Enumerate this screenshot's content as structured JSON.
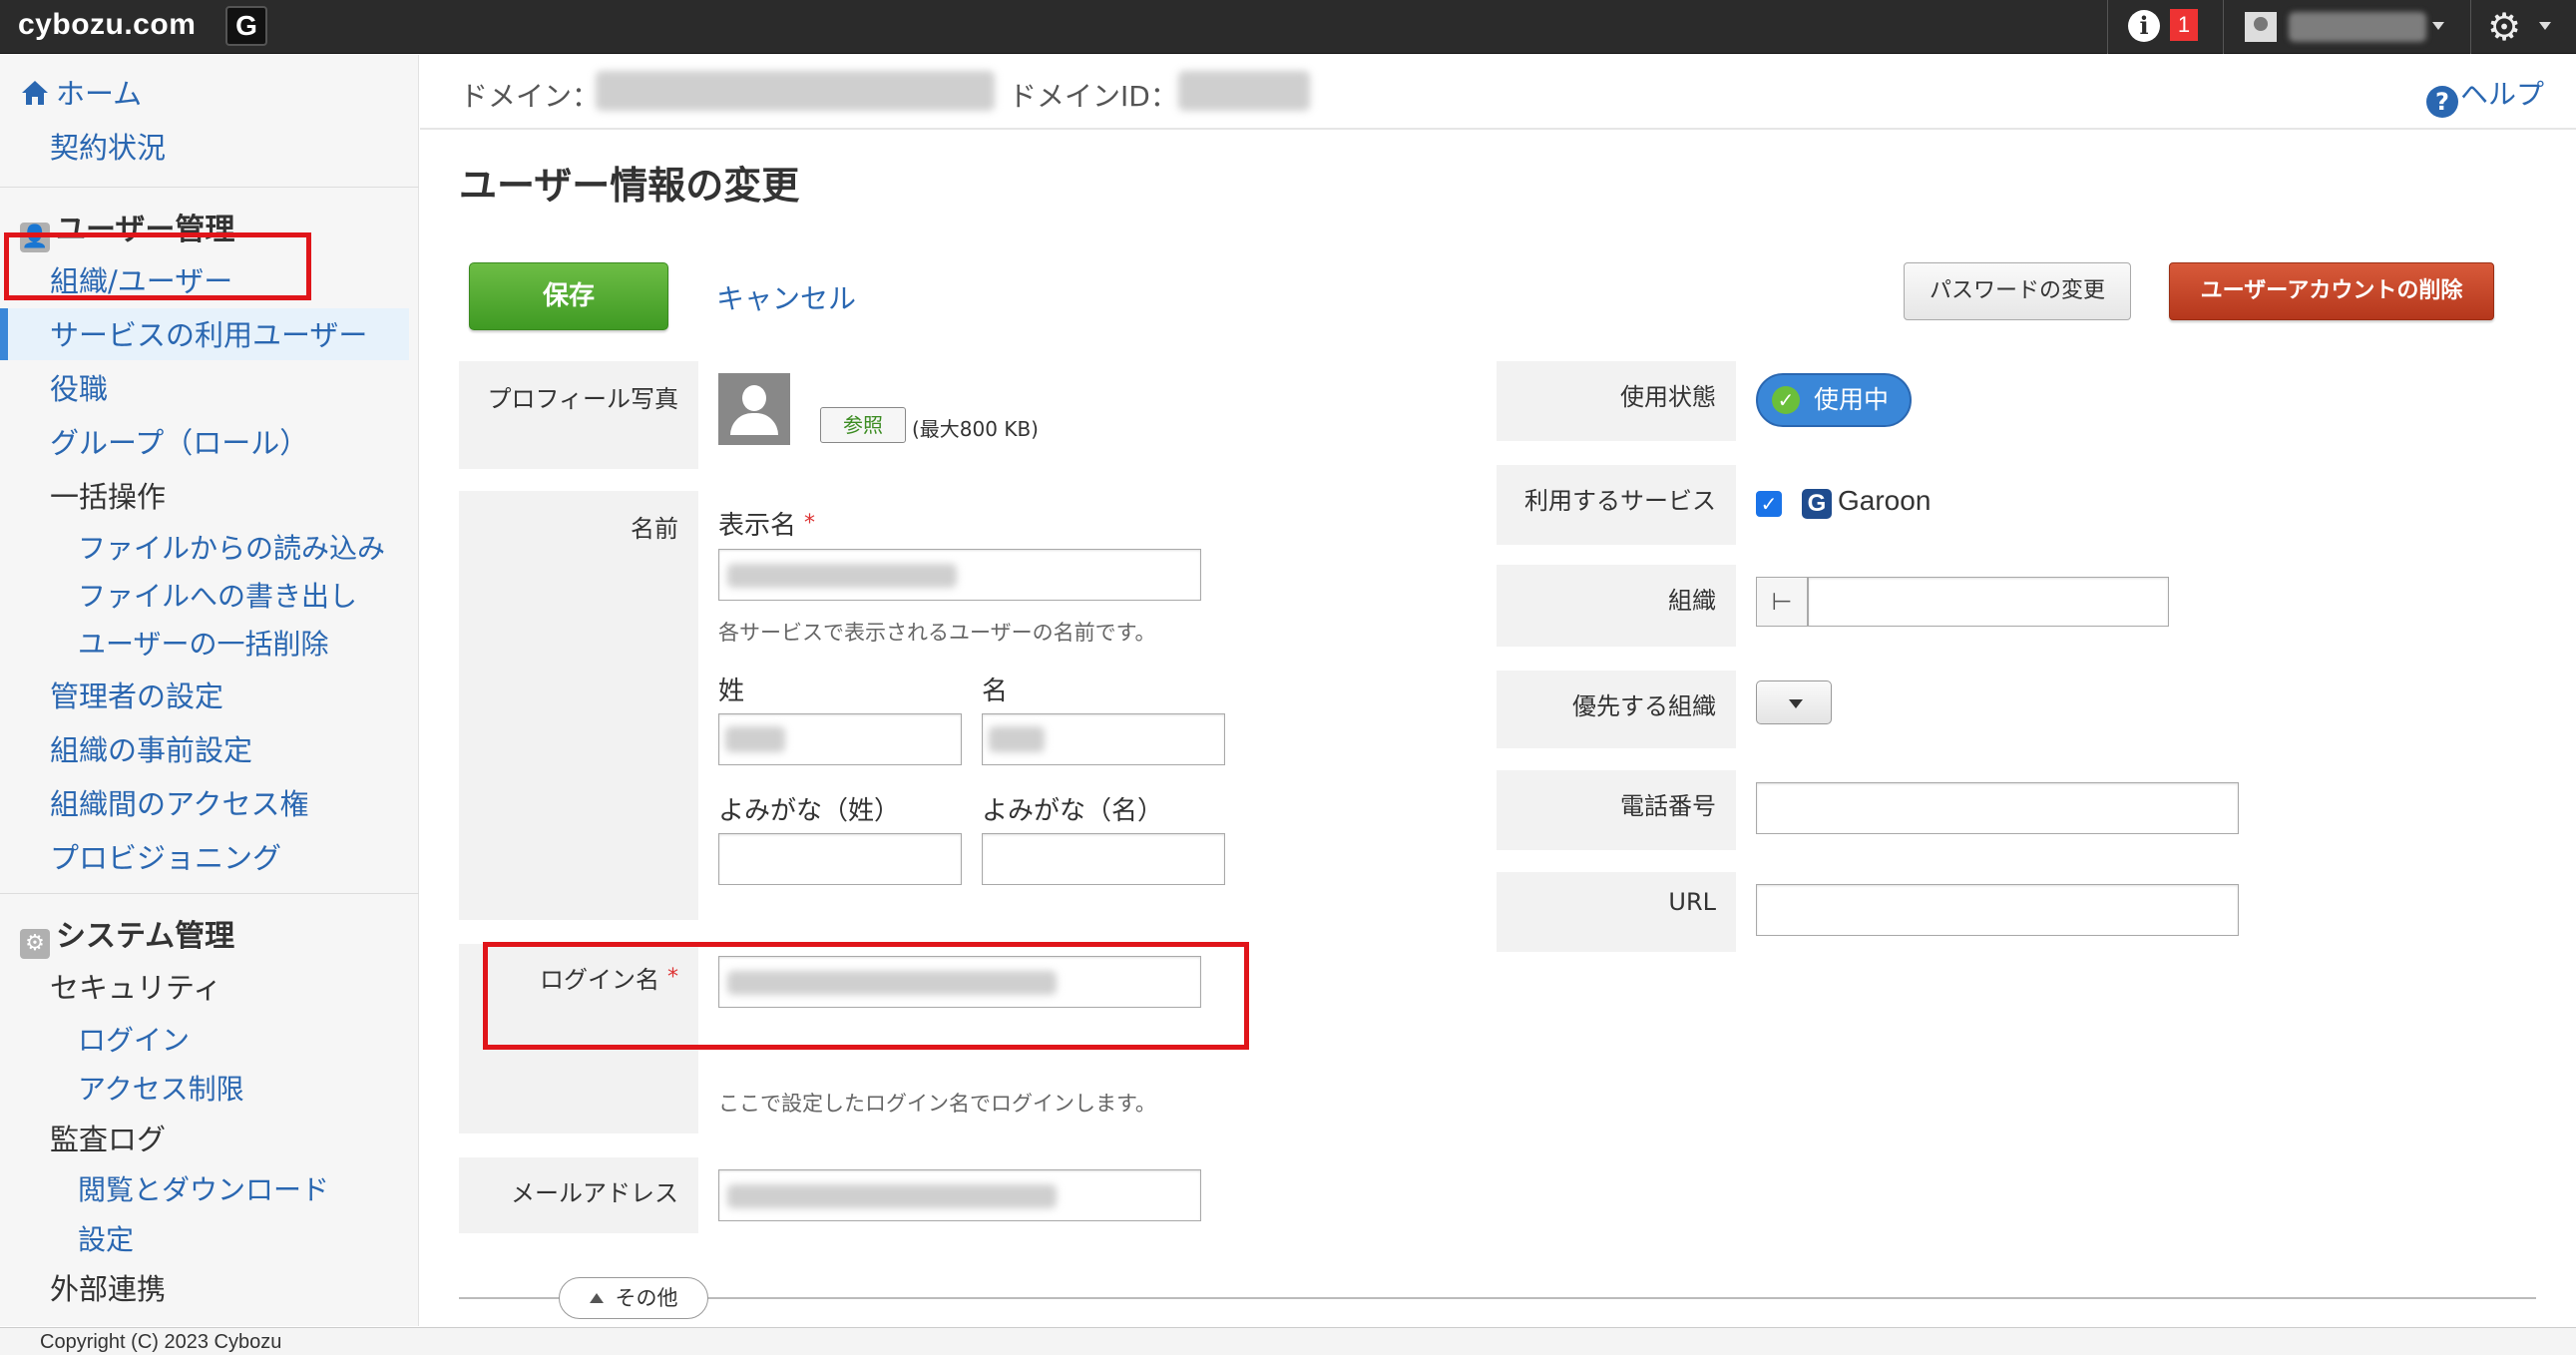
{
  "topbar": {
    "logo": "cybozu.com",
    "app_button": "G",
    "info_icon": "i",
    "notification_count": "1",
    "user_name": "",
    "icons": [
      "info-icon",
      "avatar-icon",
      "gear-icon"
    ]
  },
  "sidebar": {
    "home": "ホーム",
    "contract": "契約状況",
    "user_mgmt_header": "ユーザー管理",
    "org_users": "組織/ユーザー",
    "service_users": "サービスの利用ユーザー",
    "roles": "役職",
    "groups": "グループ（ロール）",
    "bulk_ops": "一括操作",
    "import_file": "ファイルからの読み込み",
    "export_file": "ファイルへの書き出し",
    "bulk_delete": "ユーザーの一括削除",
    "admin_settings": "管理者の設定",
    "org_preset": "組織の事前設定",
    "inter_org_access": "組織間のアクセス権",
    "provisioning": "プロビジョニング",
    "system_header": "システム管理",
    "security": "セキュリティ",
    "login": "ログイン",
    "access_restriction": "アクセス制限",
    "audit_log": "監査ログ",
    "view_download": "閲覧とダウンロード",
    "settings": "設定",
    "external_integration": "外部連携"
  },
  "domain_bar": {
    "domain_label": "ドメイン：",
    "domain_value": "",
    "domain_id_label": "ドメインID：",
    "domain_id_value": "",
    "help": "ヘルプ"
  },
  "page": {
    "title": "ユーザー情報の変更",
    "save": "保存",
    "cancel": "キャンセル",
    "change_password": "パスワードの変更",
    "delete_account": "ユーザーアカウントの削除"
  },
  "form": {
    "profile_photo_label": "プロフィール写真",
    "browse": "参照",
    "max_size": "(最大800 KB)",
    "name_label": "名前",
    "display_name_label": "表示名",
    "required_mark": "*",
    "display_name_hint": "各サービスで表示されるユーザーの名前です。",
    "last_name_label": "姓",
    "first_name_label": "名",
    "last_kana_label": "よみがな（姓）",
    "first_kana_label": "よみがな（名）",
    "login_name_label": "ログイン名",
    "login_hint": "ここで設定したログイン名でログインします。",
    "email_label": "メールアドレス",
    "status_label": "使用状態",
    "status_value": "使用中",
    "services_label": "利用するサービス",
    "service_checked": true,
    "service_name": "Garoon",
    "org_label": "組織",
    "priority_org_label": "優先する組織",
    "phone_label": "電話番号",
    "url_label": "URL",
    "other_toggle": "その他"
  },
  "footer": {
    "copyright": "Copyright (C) 2023 Cybozu"
  },
  "colors": {
    "topbar": "#2b2b2b",
    "link": "#2a67b1",
    "save_green": "#4fa92f",
    "delete_red": "#c4432a",
    "status_blue": "#3a87d8",
    "highlight_red": "#e0151a"
  }
}
